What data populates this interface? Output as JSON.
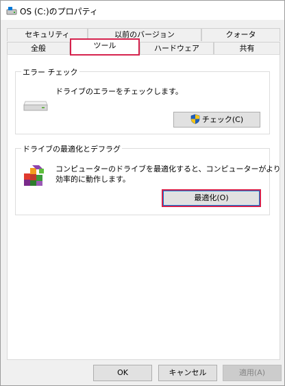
{
  "window": {
    "title": "OS (C:)のプロパティ"
  },
  "tabs": {
    "row1": [
      "セキュリティ",
      "以前のバージョン",
      "クォータ"
    ],
    "row2": [
      "全般",
      "ツール",
      "ハードウェア",
      "共有"
    ],
    "active": "ツール"
  },
  "error_check": {
    "group_label": "エラー チェック",
    "description": "ドライブのエラーをチェックします。",
    "button_label": "チェック(C)"
  },
  "optimize": {
    "group_label": "ドライブの最適化とデフラグ",
    "description_line1": "コンピューターのドライブを最適化すると、コンピューターがより",
    "description_line2": "効率的に動作します。",
    "button_label": "最適化(O)"
  },
  "footer": {
    "ok_label": "OK",
    "cancel_label": "キャンセル",
    "apply_label": "適用(A)"
  },
  "colors": {
    "highlight": "#d5214c",
    "focus_inner": "#0078d7"
  }
}
